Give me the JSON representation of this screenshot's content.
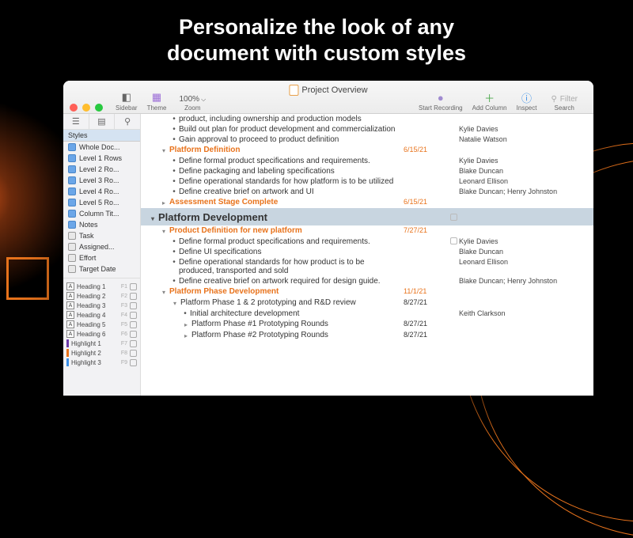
{
  "marketing": {
    "headline_l1": "Personalize the look of any",
    "headline_l2": "document with custom styles"
  },
  "window": {
    "title": "Project Overview",
    "toolbar": {
      "sidebar": "Sidebar",
      "theme": "Theme",
      "zoom": "Zoom",
      "zoom_value": "100%",
      "start_recording": "Start Recording",
      "add_column": "Add Column",
      "inspect": "Inspect",
      "search": "Search",
      "filter_placeholder": "Filter"
    }
  },
  "sidebar": {
    "styles_header": "Styles",
    "levels": [
      "Whole Doc...",
      "Level 1 Rows",
      "Level 2 Ro...",
      "Level 3 Ro...",
      "Level 4 Ro...",
      "Level 5 Ro...",
      "Column Tit..."
    ],
    "cols": [
      "Notes",
      "Task",
      "Assigned...",
      "Effort",
      "Target Date"
    ],
    "headings": [
      {
        "name": "Heading 1",
        "fn": "F1"
      },
      {
        "name": "Heading 2",
        "fn": "F2"
      },
      {
        "name": "Heading 3",
        "fn": "F3"
      },
      {
        "name": "Heading 4",
        "fn": "F4"
      },
      {
        "name": "Heading 5",
        "fn": "F5"
      },
      {
        "name": "Heading 6",
        "fn": "F6"
      }
    ],
    "highlights": [
      {
        "name": "Highlight 1",
        "fn": "F7",
        "color": "#6b3aa8"
      },
      {
        "name": "Highlight 2",
        "fn": "F8",
        "color": "#e8731c"
      },
      {
        "name": "Highlight 3",
        "fn": "F9",
        "color": "#3a8fe8"
      }
    ]
  },
  "outline": {
    "rows": [
      {
        "type": "item",
        "indent": 36,
        "text": "product, including ownership and production models",
        "asg": "",
        "date": ""
      },
      {
        "type": "item",
        "indent": 36,
        "text": "Build out plan for product development and commercialization",
        "asg": "Kylie Davies",
        "date": ""
      },
      {
        "type": "item",
        "indent": 36,
        "text": "Gain approval to proceed to product definition",
        "asg": "Natalie Watson",
        "date": ""
      },
      {
        "type": "head",
        "indent": 22,
        "text": "Platform Definition",
        "asg": "",
        "date": "6/15/21",
        "orange": true
      },
      {
        "type": "item",
        "indent": 36,
        "text": "Define formal product specifications and requirements.",
        "asg": "Kylie Davies",
        "date": ""
      },
      {
        "type": "item",
        "indent": 36,
        "text": "Define packaging and labeling specifications",
        "asg": "Blake Duncan",
        "date": ""
      },
      {
        "type": "item",
        "indent": 36,
        "text": "Define operational standards for how platform is to be utilized",
        "asg": "Leonard Ellison",
        "date": ""
      },
      {
        "type": "item",
        "indent": 36,
        "text": "Define creative brief on artwork and UI",
        "asg": "Blake Duncan; Henry Johnston",
        "date": ""
      },
      {
        "type": "head",
        "indent": 22,
        "text": "Assessment Stage Complete",
        "asg": "",
        "date": "6/15/21",
        "orange": true,
        "closed": true
      },
      {
        "type": "section",
        "text": "Platform Development"
      },
      {
        "type": "head",
        "indent": 22,
        "text": "Product Definition for new platform",
        "asg": "",
        "date": "7/27/21",
        "orange": true
      },
      {
        "type": "item",
        "indent": 36,
        "text": "Define formal product specifications and requirements.",
        "asg": "Kylie Davies",
        "date": "",
        "cb": true
      },
      {
        "type": "item",
        "indent": 36,
        "text": "Define UI specifications",
        "asg": "Blake Duncan",
        "date": ""
      },
      {
        "type": "item2",
        "indent": 36,
        "text": "Define operational standards for how product is to be produced, transported and sold",
        "asg": "Leonard Ellison",
        "date": ""
      },
      {
        "type": "item",
        "indent": 36,
        "text": "Define creative brief on artwork required for design guide.",
        "asg": "Blake Duncan; Henry Johnston",
        "date": ""
      },
      {
        "type": "head",
        "indent": 22,
        "text": "Platform Phase Development",
        "asg": "",
        "date": "11/1/21",
        "orange": true
      },
      {
        "type": "sub",
        "indent": 36,
        "text": "Platform Phase 1 & 2 prototyping and R&D review",
        "asg": "",
        "date": "8/27/21"
      },
      {
        "type": "item",
        "indent": 50,
        "text": "Initial architecture development",
        "asg": "Keith Clarkson",
        "date": ""
      },
      {
        "type": "sub",
        "indent": 50,
        "text": "Platform Phase #1 Prototyping Rounds",
        "asg": "",
        "date": "8/27/21",
        "closed": true
      },
      {
        "type": "sub",
        "indent": 50,
        "text": "Platform Phase #2 Prototyping Rounds",
        "asg": "",
        "date": "8/27/21",
        "closed": true
      }
    ]
  }
}
